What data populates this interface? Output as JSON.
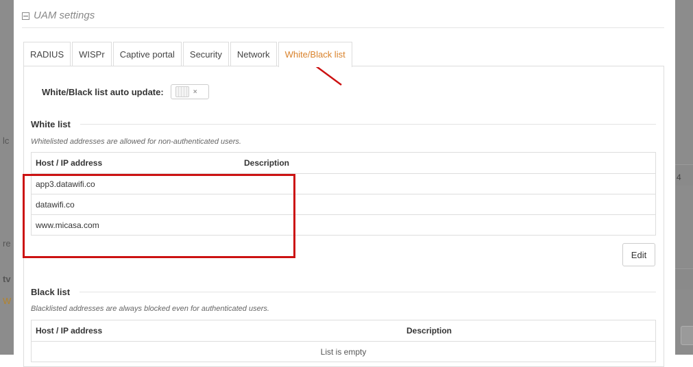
{
  "backdrop": {
    "left_fragments": [
      "lc",
      "re",
      "tv",
      "W"
    ],
    "right_fragment": "4"
  },
  "section": {
    "title": "UAM settings",
    "icon": "collapse-minus-icon"
  },
  "tabs": [
    {
      "label": "RADIUS",
      "active": false
    },
    {
      "label": "WISPr",
      "active": false
    },
    {
      "label": "Captive portal",
      "active": false
    },
    {
      "label": "Security",
      "active": false
    },
    {
      "label": "Network",
      "active": false
    },
    {
      "label": "White/Black list",
      "active": true
    }
  ],
  "auto_update": {
    "label": "White/Black list auto update:",
    "enabled": false,
    "off_mark": "×"
  },
  "white_list": {
    "heading": "White list",
    "hint": "Whitelisted addresses are allowed for non-authenticated users.",
    "columns": [
      "Host / IP address",
      "Description"
    ],
    "rows": [
      {
        "host": "app3.datawifi.co",
        "description": ""
      },
      {
        "host": "datawifi.co",
        "description": ""
      },
      {
        "host": "www.micasa.com",
        "description": ""
      }
    ],
    "edit_label": "Edit"
  },
  "black_list": {
    "heading": "Black list",
    "hint": "Blacklisted addresses are always blocked even for authenticated users.",
    "columns": [
      "Host / IP address",
      "Description"
    ],
    "empty_text": "List is empty"
  },
  "colors": {
    "active_tab": "#d9822b",
    "annotation": "#cc1111",
    "border": "#dddddd"
  }
}
